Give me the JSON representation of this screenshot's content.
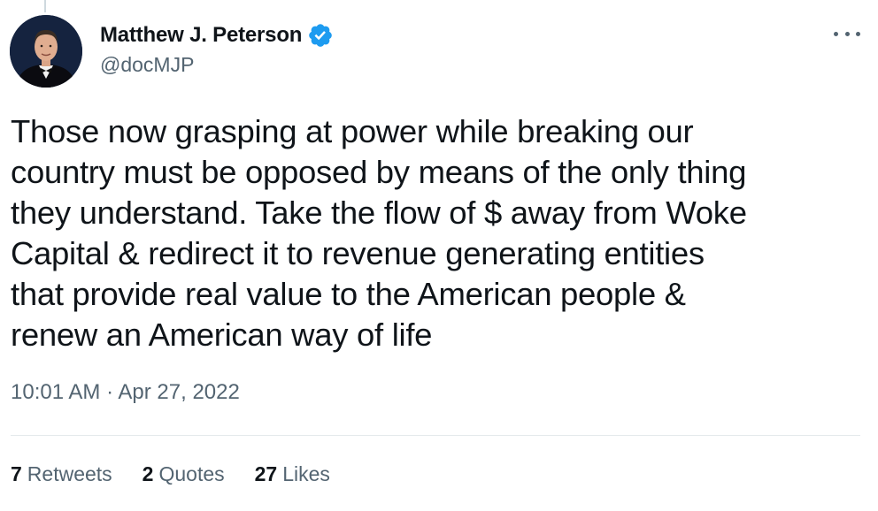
{
  "tweet": {
    "author": {
      "display_name": "Matthew J. Peterson",
      "handle": "@docMJP",
      "verified": true,
      "avatar_icon": "profile-photo",
      "verified_icon": "verified-badge-icon"
    },
    "more_icon": "more-options-icon",
    "text": "Those now grasping at power while breaking our\ncountry must be opposed by means of the only thing\nthey understand. Take the flow of $ away from Woke\nCapital & redirect it to revenue generating entities\nthat provide real value to the American people &\nrenew an American way of life",
    "timestamp": "10:01 AM · Apr 27, 2022",
    "stats": {
      "retweets": {
        "count": "7",
        "label": "Retweets"
      },
      "quotes": {
        "count": "2",
        "label": "Quotes"
      },
      "likes": {
        "count": "27",
        "label": "Likes"
      }
    }
  },
  "colors": {
    "text_primary": "#0f1419",
    "text_secondary": "#536471",
    "verified_blue": "#1d9bf0",
    "divider": "#e4e9ec"
  }
}
